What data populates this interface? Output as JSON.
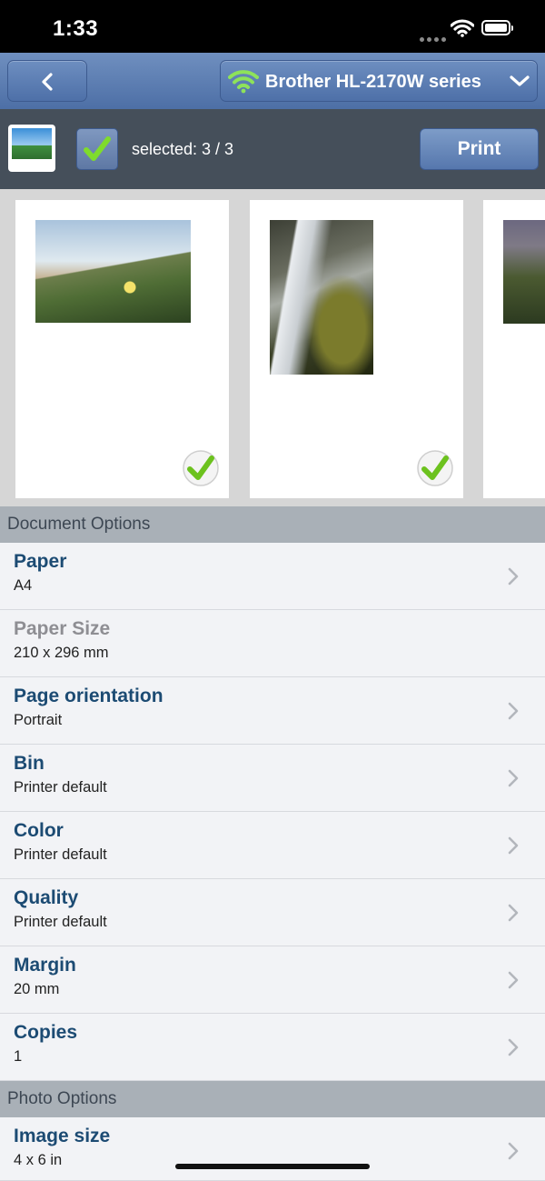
{
  "status_bar": {
    "time": "1:33"
  },
  "nav": {
    "printer_name": "Brother HL-2170W series"
  },
  "toolbar": {
    "selected_text": "selected: 3 / 3",
    "print_label": "Print"
  },
  "sections": {
    "document_options": "Document Options",
    "photo_options": "Photo Options"
  },
  "document_options": [
    {
      "label": "Paper",
      "value": "A4"
    },
    {
      "label": "Paper Size",
      "value": "210 x 296 mm"
    },
    {
      "label": "Page orientation",
      "value": "Portrait"
    },
    {
      "label": "Bin",
      "value": "Printer default"
    },
    {
      "label": "Color",
      "value": "Printer default"
    },
    {
      "label": "Quality",
      "value": "Printer default"
    },
    {
      "label": "Margin",
      "value": "20 mm"
    },
    {
      "label": "Copies",
      "value": "1"
    }
  ],
  "photo_options": [
    {
      "label": "Image size",
      "value": "4 x 6 in"
    }
  ],
  "colors": {
    "nav_bar": "#5a7bb0",
    "toolbar": "#454f5a",
    "section_header": "#a9b0b7",
    "option_label": "#1c4b73",
    "check_green": "#6cc21e"
  }
}
